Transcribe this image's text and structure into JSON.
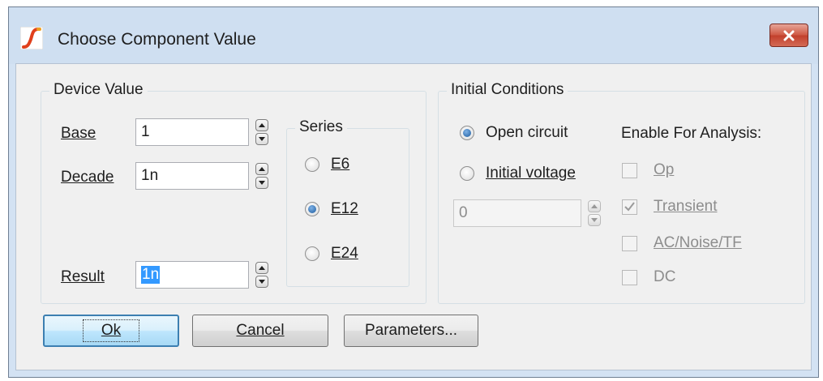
{
  "window": {
    "title": "Choose Component Value",
    "app_icon": "simetrix-icon",
    "close_icon": "close-icon"
  },
  "device_value": {
    "legend": "Device Value",
    "base": {
      "label": "Base",
      "value": "1"
    },
    "decade": {
      "label": "Decade",
      "value": "1n"
    },
    "result": {
      "label": "Result",
      "value": "1n"
    }
  },
  "series": {
    "legend": "Series",
    "options": [
      {
        "label": "E6",
        "checked": false
      },
      {
        "label": "E12",
        "checked": true
      },
      {
        "label": "E24",
        "checked": false
      }
    ]
  },
  "initial_conditions": {
    "legend": "Initial Conditions",
    "open_circuit": {
      "label": "Open circuit",
      "checked": true
    },
    "initial_voltage": {
      "label": "Initial voltage",
      "checked": false
    },
    "voltage_value": "0"
  },
  "enable_for_analysis": {
    "heading": "Enable For Analysis:",
    "items": [
      {
        "label": "Op",
        "checked": false
      },
      {
        "label": "Transient",
        "checked": true
      },
      {
        "label": "AC/Noise/TF",
        "checked": false
      },
      {
        "label": "DC",
        "checked": false
      }
    ]
  },
  "buttons": {
    "ok": "Ok",
    "cancel": "Cancel",
    "parameters": "Parameters..."
  },
  "colors": {
    "frame": "#d3e2f3",
    "client": "#f0f0f0",
    "selection": "#3399ff",
    "close": "#c2402c"
  }
}
